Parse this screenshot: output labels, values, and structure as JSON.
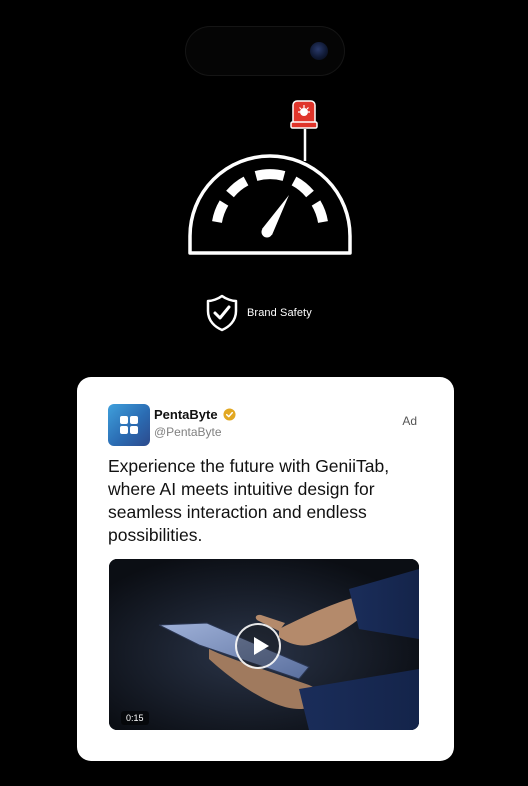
{
  "icons": {
    "dynamic_island": "dynamic-island",
    "gauge": "speedometer-gauge-icon",
    "alert": "red-siren-icon",
    "shield": "shield-check-icon",
    "avatar": "app-grid-logo",
    "verified": "verified-badge-icon",
    "play": "play-icon"
  },
  "brand_safety": {
    "label": "Brand Safety"
  },
  "post": {
    "display_name": "PentaByte",
    "handle": "@PentaByte",
    "ad_label": "Ad",
    "text": "Experience the future with GeniiTab, where AI meets intuitive design for seamless interaction and endless possibilities.",
    "video": {
      "duration": "0:15"
    }
  },
  "colors": {
    "background": "#000000",
    "card": "#ffffff",
    "avatar_gradient_start": "#3fa0dc",
    "avatar_gradient_end": "#2c4a8c",
    "verified_badge": "#e2a822",
    "siren": "#e0352b"
  }
}
